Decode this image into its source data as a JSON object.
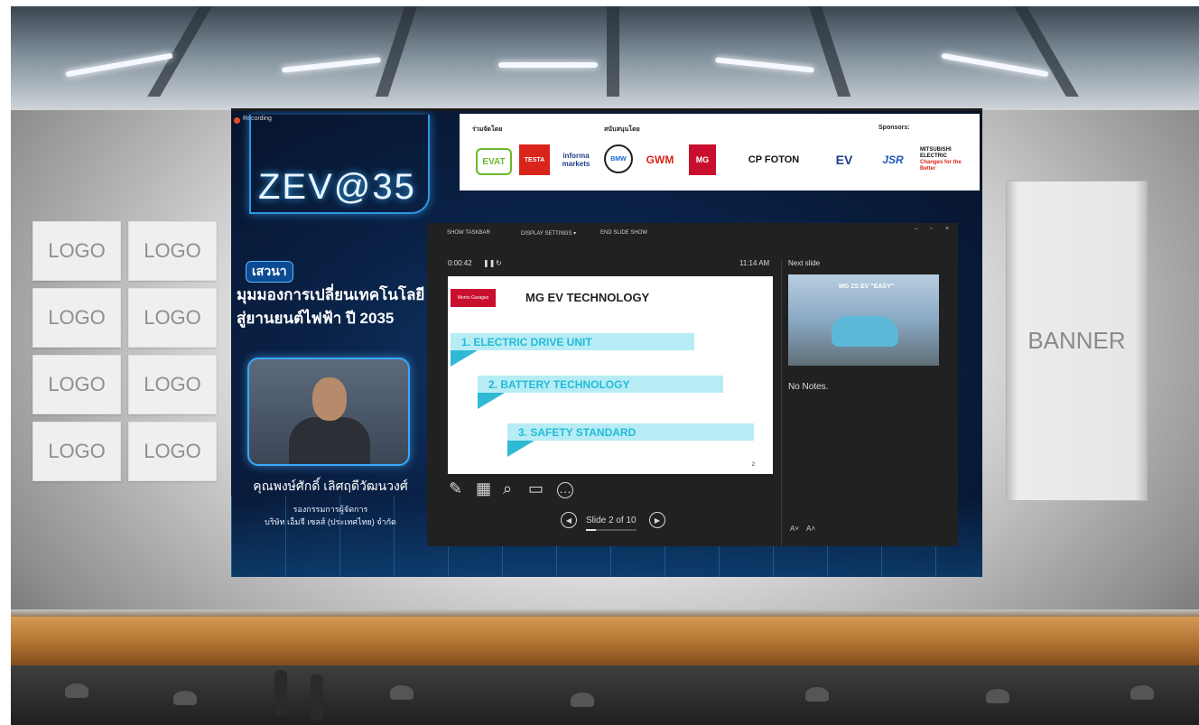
{
  "stage": {
    "logo_tiles": [
      "LOGO",
      "LOGO",
      "LOGO",
      "LOGO",
      "LOGO",
      "LOGO",
      "LOGO",
      "LOGO"
    ],
    "banner_label": "BANNER"
  },
  "screen": {
    "recording_label": "Recording",
    "event_logo_text": "ZEV@35",
    "sponsor_bar": {
      "coorganizer_label": "ร่วมจัดโดย",
      "supporter_label": "สนับสนุนโดย",
      "sponsors_label": "Sponsors:",
      "logos": [
        "EVAT",
        "TESTA",
        "informa markets",
        "BMW",
        "GWM",
        "MG",
        "CP FOTON",
        "EV",
        "JSR",
        "MITSUBISHI ELECTRIC"
      ],
      "logo_sublabels": {
        "mitsubishi": "Changes for the Better"
      }
    },
    "topic": {
      "badge": "เสวนา",
      "line1": "มุมมองการเปลี่ยนเทคโนโลยี",
      "line2": "สู่ยานยนต์ไฟฟ้า ปี 2035"
    },
    "speaker": {
      "name": "คุณพงษ์ศักดิ์ เลิศฤดีวัฒนวงศ์",
      "role": "รองกรรมการผู้จัดการ",
      "company": "บริษัท เอ็มจี เซลส์ (ประเทศไทย) จำกัด"
    }
  },
  "presenter_view": {
    "toolbar": {
      "show_taskbar": "SHOW TASKBAR",
      "display_settings": "DISPLAY SETTINGS ▾",
      "end_slide_show": "END SLIDE SHOW"
    },
    "timer": "0:00:42",
    "clock": "11:14 AM",
    "next_slide_label": "Next slide",
    "next_slide_title": "MG ZS EV \"EASY\"",
    "notes": "No Notes.",
    "slide_counter": "Slide 2 of 10",
    "progress": 0.2,
    "current_slide": {
      "badge": "Morris Garages",
      "title": "MG EV TECHNOLOGY",
      "bullets": [
        "1. ELECTRIC DRIVE UNIT",
        "2. BATTERY TECHNOLOGY",
        "3. SAFETY STANDARD"
      ],
      "page_number": "2"
    }
  }
}
